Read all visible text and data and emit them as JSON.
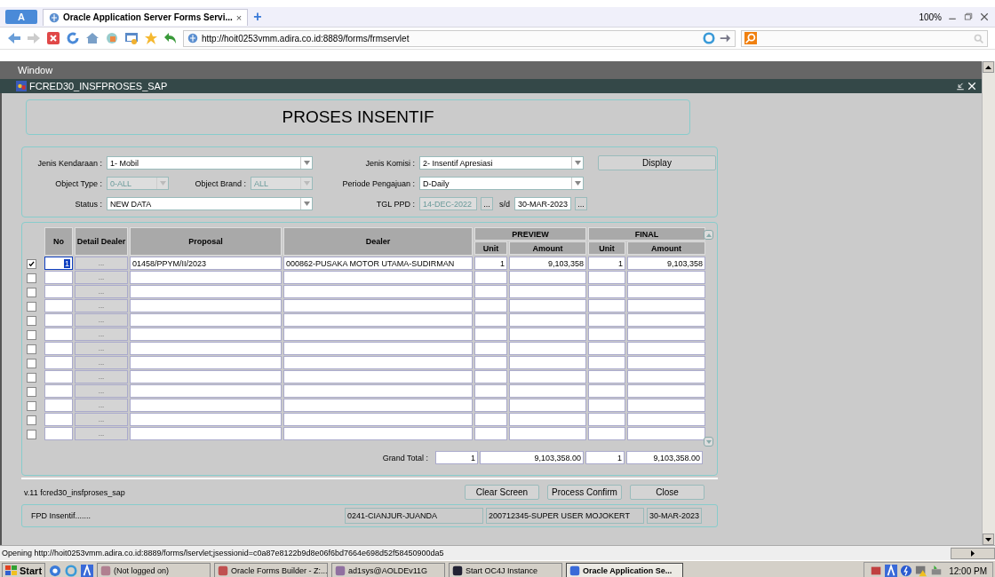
{
  "browser": {
    "menu_button": "A",
    "tab": {
      "title": "Oracle Application Server Forms Servi...",
      "close": "×",
      "selected": true
    },
    "new_tab": "+",
    "zoom": "100%",
    "url": "http://hoit0253vmm.adira.co.id:8889/forms/frmservlet",
    "status": "Opening http://hoit0253vmm.adira.co.id:8889/forms/lservlet;jsessionid=c0a87e8122b9d8e06f6bd7664e698d52f58450900da5"
  },
  "window": {
    "menu": [
      "Window"
    ],
    "title": "FCRED30_INSFPROSES_SAP"
  },
  "header": {
    "title": "PROSES INSENTIF"
  },
  "filter_rows": [
    {
      "fields": [
        {
          "label": "Jenis Kendaraan :",
          "value": "1- Mobil",
          "kind": "dropdown",
          "disabled": false
        },
        {
          "label": "Jenis Komisi :",
          "value": "2- Insentif Apresiasi",
          "kind": "dropdown",
          "disabled": false
        }
      ]
    },
    {
      "fields": [
        {
          "label": "Object Type :",
          "value": "0-ALL",
          "kind": "dropdown",
          "disabled": true
        },
        {
          "label": "Object Brand :",
          "value": "ALL",
          "kind": "dropdown",
          "disabled": true
        },
        {
          "label": "Periode Pengajuan :",
          "value": "D-Daily",
          "kind": "dropdown",
          "disabled": false
        }
      ]
    },
    {
      "fields": [
        {
          "label": "Status :",
          "value": "NEW DATA",
          "kind": "dropdown",
          "disabled": false
        },
        {
          "label": "TGL PPD :",
          "value": "14-DEC-2022",
          "kind": "date",
          "button": "...",
          "disabled": true
        },
        {
          "label": "s/d",
          "value": "30-MAR-2023",
          "kind": "date",
          "button": "...",
          "disabled": false
        }
      ]
    }
  ],
  "display_button": "Display",
  "table": {
    "columns": [
      "No",
      "Detail Dealer",
      "Proposal",
      "Dealer"
    ],
    "groups": [
      {
        "title": "PREVIEW",
        "columns": [
          "Unit",
          "Amount"
        ]
      },
      {
        "title": "FINAL",
        "columns": [
          "Unit",
          "Amount"
        ]
      }
    ],
    "rows": [
      {
        "checked": true,
        "selected": true,
        "no": "1",
        "detail": "...",
        "proposal": "01458/PPYM/II/2023",
        "dealer": "000862-PUSAKA MOTOR UTAMA-SUDIRMAN",
        "preview_unit": "1",
        "preview_amount": "9,103,358",
        "final_unit": "1",
        "final_amount": "9,103,358"
      },
      {
        "checked": false,
        "selected": false,
        "detail": "..."
      },
      {
        "checked": false,
        "selected": false,
        "detail": "..."
      },
      {
        "checked": false,
        "selected": false,
        "detail": "..."
      },
      {
        "checked": false,
        "selected": false,
        "detail": "..."
      },
      {
        "checked": false,
        "selected": false,
        "detail": "..."
      },
      {
        "checked": false,
        "selected": false,
        "detail": "..."
      },
      {
        "checked": false,
        "selected": false,
        "detail": "..."
      },
      {
        "checked": false,
        "selected": false,
        "detail": "..."
      },
      {
        "checked": false,
        "selected": false,
        "detail": "..."
      },
      {
        "checked": false,
        "selected": false,
        "detail": "..."
      },
      {
        "checked": false,
        "selected": false,
        "detail": "..."
      },
      {
        "checked": false,
        "selected": false,
        "detail": "..."
      }
    ],
    "grand_total": {
      "label": "Grand Total :",
      "preview_unit": "1",
      "preview_amount": "9,103,358.00",
      "final_unit": "1",
      "final_amount": "9,103,358.00"
    }
  },
  "version": "v.11 fcred30_insfproses_sap",
  "buttons": [
    "Clear Screen",
    "Process Confirm",
    "Close"
  ],
  "status_fields": [
    "FPD Insentif.......",
    "0241-CIANJUR-JUANDA",
    "200712345-SUPER USER MOJOKERT",
    "30-MAR-2023"
  ],
  "taskbar": {
    "start": "Start",
    "items": [
      {
        "label": "(Not logged on)",
        "selected": false
      },
      {
        "label": "Oracle Forms Builder - Z:...",
        "selected": false
      },
      {
        "label": "ad1sys@AOLDEv11G",
        "selected": false
      },
      {
        "label": "Start OC4J Instance",
        "selected": false
      },
      {
        "label": "Oracle Application Se...",
        "selected": true
      }
    ],
    "clock": "12:00 PM"
  }
}
